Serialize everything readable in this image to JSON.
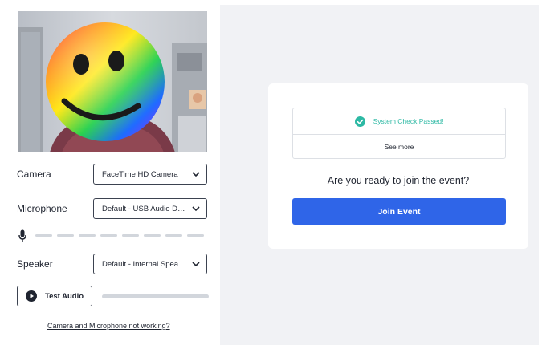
{
  "video": {
    "label": "camera-preview"
  },
  "camera": {
    "label": "Camera",
    "value": "FaceTime HD Camera"
  },
  "microphone": {
    "label": "Microphone",
    "value": "Default - USB Audio Device",
    "level_fraction": 0
  },
  "speaker": {
    "label": "Speaker",
    "value": "Default - Internal Speakers"
  },
  "test_audio": {
    "label": "Test Audio",
    "progress_fraction": 0
  },
  "help_link": "Camera and Microphone not working?",
  "system_check": {
    "status": "System Check Passed!",
    "see_more": "See more"
  },
  "prompt": "Are you ready to join the event?",
  "join_button": "Join Event",
  "colors": {
    "accent": "#2f65e8",
    "success": "#2db9a4",
    "background": "#f1f2f5"
  },
  "icons": {
    "chevron": "chevron-down-icon",
    "mic": "microphone-icon",
    "play": "play-icon",
    "check": "check-circle-icon"
  }
}
